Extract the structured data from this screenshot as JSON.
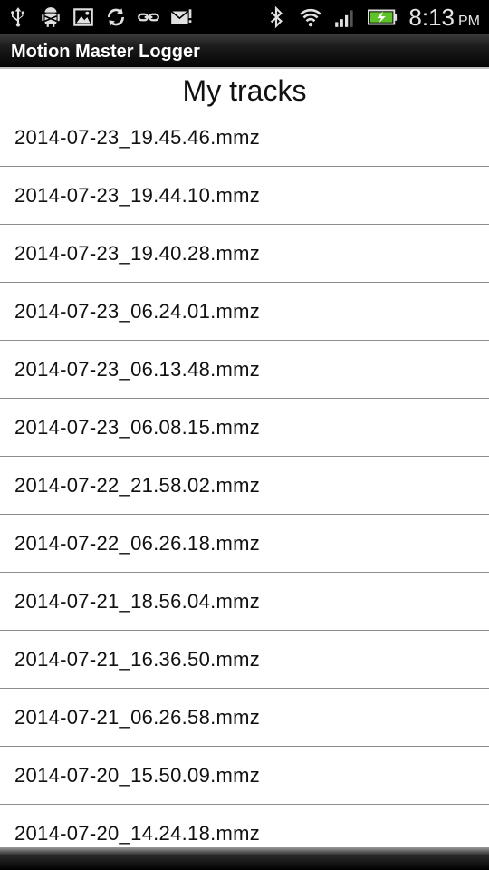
{
  "status_bar": {
    "icons_left": [
      "usb-icon",
      "android-debug-icon",
      "image-icon",
      "sync-icon",
      "link-icon",
      "mail-icon"
    ],
    "icons_right": [
      "bluetooth-icon",
      "wifi-icon",
      "signal-icon",
      "battery-charging-icon"
    ],
    "time": "8:13",
    "ampm": "PM"
  },
  "app": {
    "title": "Motion Master Logger"
  },
  "header": {
    "title": "My tracks"
  },
  "tracks": [
    "2014-07-23_19.45.46.mmz",
    "2014-07-23_19.44.10.mmz",
    "2014-07-23_19.40.28.mmz",
    "2014-07-23_06.24.01.mmz",
    "2014-07-23_06.13.48.mmz",
    "2014-07-23_06.08.15.mmz",
    "2014-07-22_21.58.02.mmz",
    "2014-07-22_06.26.18.mmz",
    "2014-07-21_18.56.04.mmz",
    "2014-07-21_16.36.50.mmz",
    "2014-07-21_06.26.58.mmz",
    "2014-07-20_15.50.09.mmz",
    "2014-07-20_14.24.18.mmz"
  ],
  "colors": {
    "status_bar_bg": "#000000",
    "title_bar_bg": "#111111",
    "battery_charge": "#5ec22a",
    "text": "#111111",
    "divider": "#8c8c8c"
  }
}
